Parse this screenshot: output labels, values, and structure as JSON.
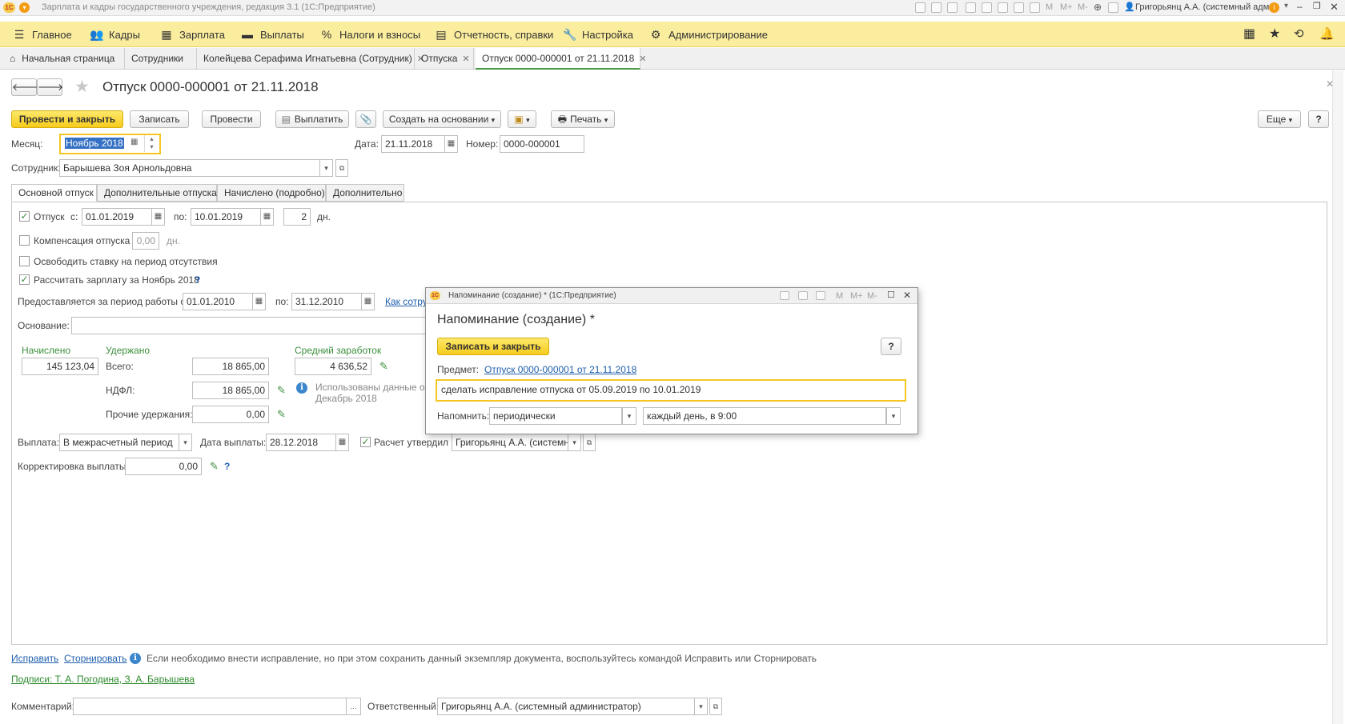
{
  "app": {
    "title": "Зарплата и кадры государственного учреждения, редакция 3.1  (1С:Предприятие)",
    "user": "Григорьянц А.А. (системный адм...",
    "logo": "1С",
    "mem_labels": [
      "M",
      "M+",
      "M-"
    ]
  },
  "main_menu": [
    {
      "label": "Главное",
      "icon": "hamburger-icon"
    },
    {
      "label": "Кадры",
      "icon": "people-icon"
    },
    {
      "label": "Зарплата",
      "icon": "calculator-icon"
    },
    {
      "label": "Выплаты",
      "icon": "wallet-icon"
    },
    {
      "label": "Налоги и взносы",
      "icon": "percent-icon"
    },
    {
      "label": "Отчетность, справки",
      "icon": "report-icon"
    },
    {
      "label": "Настройка",
      "icon": "wrench-icon"
    },
    {
      "label": "Администрирование",
      "icon": "gear-icon"
    }
  ],
  "open_tabs": [
    {
      "label": "Начальная страница"
    },
    {
      "label": "Сотрудники"
    },
    {
      "label": "Колейцева Серафима Игнатьевна (Сотрудник)"
    },
    {
      "label": "Отпуска"
    },
    {
      "label": "Отпуск 0000-000001 от 21.11.2018"
    }
  ],
  "doc": {
    "title": "Отпуск 0000-000001 от 21.11.2018",
    "toolbar": {
      "post_close": "Провести и закрыть",
      "save": "Записать",
      "post": "Провести",
      "pay": "Выплатить",
      "create_based": "Создать на основании",
      "print": "Печать",
      "more": "Еще",
      "help": "?"
    },
    "month_label": "Месяц:",
    "month_value": "Ноябрь 2018",
    "date_label": "Дата:",
    "date_value": "21.11.2018",
    "number_label": "Номер:",
    "number_value": "0000-000001",
    "employee_label": "Сотрудник:",
    "employee_value": "Барышева Зоя Арнольдовна",
    "tabs": [
      "Основной отпуск",
      "Дополнительные отпуска",
      "Начислено (подробно)",
      "Дополнительно"
    ],
    "vacation": {
      "label": "Отпуск",
      "from_label": "с:",
      "from": "01.01.2019",
      "to_label": "по:",
      "to": "10.01.2019",
      "days": "2",
      "days_unit": "дн."
    },
    "compensation": {
      "label": "Компенсация отпуска",
      "value": "0,00",
      "unit": "дн."
    },
    "release_rate_label": "Освободить ставку на период отсутствия",
    "calc_salary_label": "Рассчитать зарплату за Ноябрь 2018",
    "period": {
      "label": "Предоставляется за период работы с:",
      "from": "01.01.2010",
      "to_label": "по:",
      "to": "31.12.2010",
      "link": "Как сотру"
    },
    "basis_label": "Основание:",
    "basis_value": "",
    "accrued_label": "Начислено",
    "accrued_value": "145 123,04",
    "withheld_label": "Удержано",
    "total_label": "Всего:",
    "total_value": "18 865,00",
    "ndfl_label": "НДФЛ:",
    "ndfl_value": "18 865,00",
    "other_label": "Прочие удержания:",
    "other_value": "0,00",
    "avg_label": "Средний заработок",
    "avg_value": "4 636,52",
    "info_text_1": "Использованы данные о",
    "info_text_2": "Декабрь 2018",
    "payout_label": "Выплата:",
    "payout_value": "В межрасчетный период",
    "payout_date_label": "Дата выплаты:",
    "payout_date": "28.12.2018",
    "approved_label": "Расчет утвердил",
    "approved_value": "Григорьянц А.А. (системны",
    "correction_label": "Корректировка выплаты:",
    "correction_value": "0,00",
    "footer": {
      "fix_link": "Исправить",
      "storno_link": "Сторнировать",
      "hint": "Если необходимо внести исправление, но при этом сохранить данный экземпляр документа, воспользуйтесь командой Исправить или Сторнировать",
      "signatures": "Подписи: Т. А. Погодина, З. А. Барышева",
      "comment_label": "Комментарий:",
      "comment_value": "",
      "responsible_label": "Ответственный:",
      "responsible_value": "Григорьянц А.А. (системный администратор)"
    }
  },
  "dialog": {
    "window_title": "Напоминание (создание) * (1С:Предприятие)",
    "heading": "Напоминание (создание) *",
    "save_close": "Записать и закрыть",
    "help": "?",
    "subject_label": "Предмет:",
    "subject_link": "Отпуск 0000-000001 от 21.11.2018",
    "text": "сделать исправление отпуска от 05.09.2019 по 10.01.2019",
    "remind_label": "Напомнить:",
    "remind_type": "периодически",
    "remind_schedule": "каждый день, в 9:00"
  },
  "colors": {
    "menu_bg": "#fbed9e",
    "accent_yellow": "#f6cc1c",
    "link": "#1f5fad",
    "green": "#3c8e3c"
  }
}
